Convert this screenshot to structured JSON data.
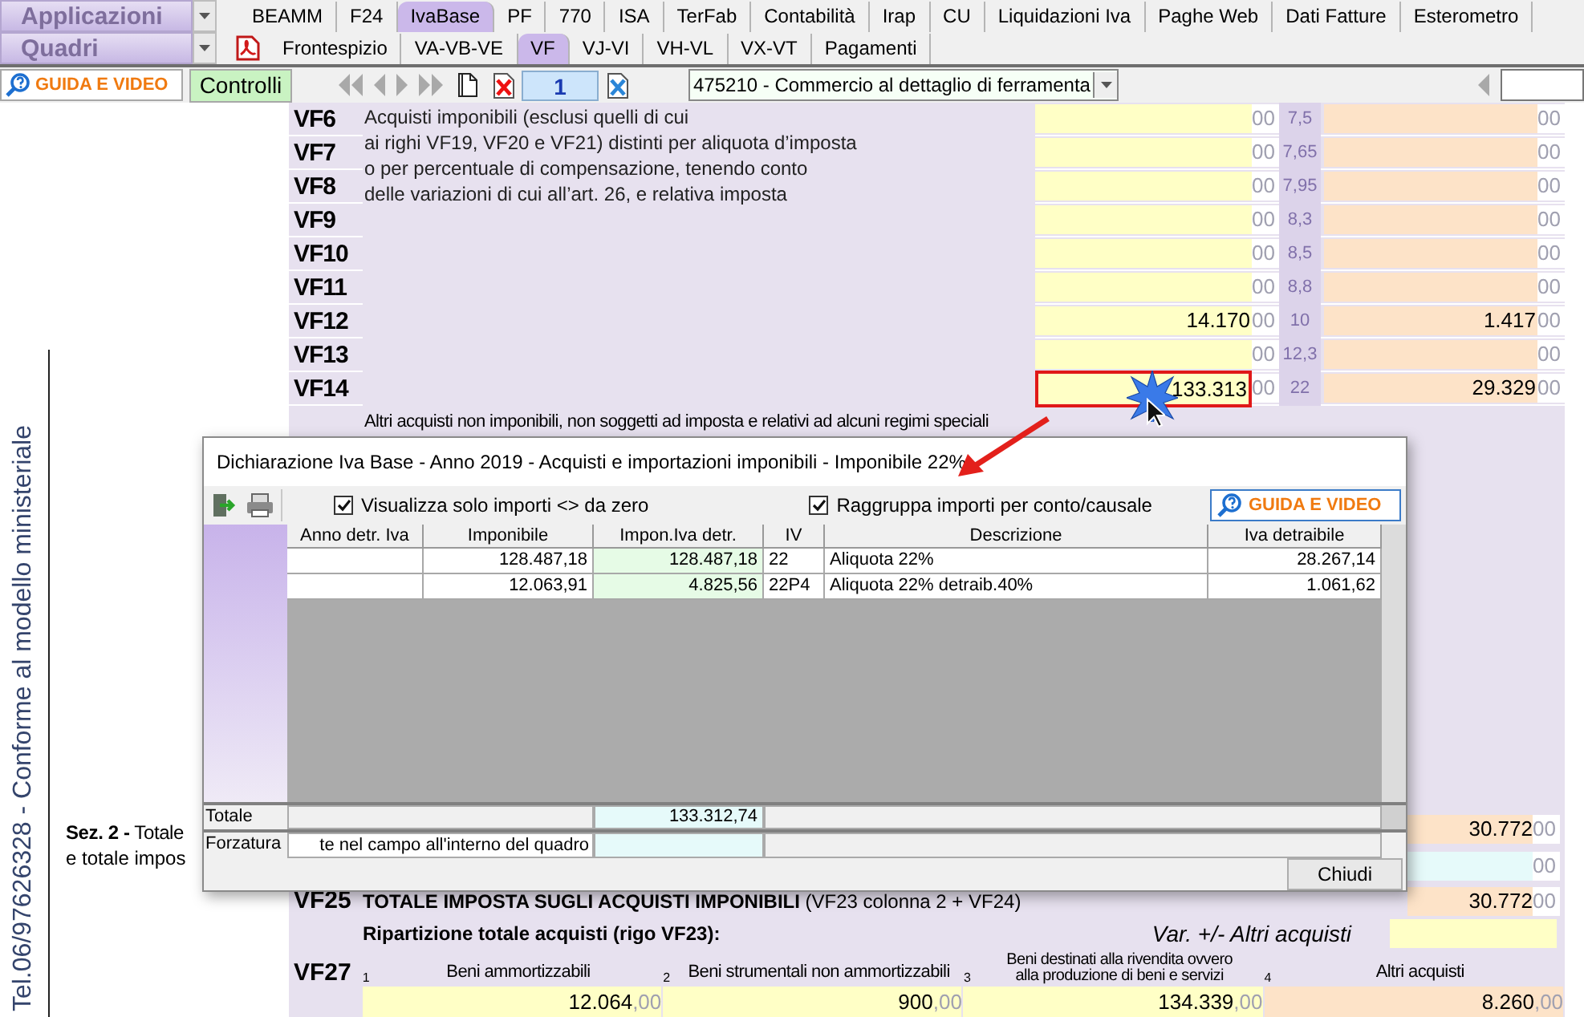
{
  "menus": [
    {
      "label": "Applicazioni"
    },
    {
      "label": "Quadri"
    }
  ],
  "app_tabs": [
    {
      "label": "BEAMM",
      "selected": false
    },
    {
      "label": "F24",
      "selected": false
    },
    {
      "label": "IvaBase",
      "selected": true
    },
    {
      "label": "PF",
      "selected": false
    },
    {
      "label": "770",
      "selected": false
    },
    {
      "label": "ISA",
      "selected": false
    },
    {
      "label": "TerFab",
      "selected": false
    },
    {
      "label": "Contabilità",
      "selected": false
    },
    {
      "label": "Irap",
      "selected": false
    },
    {
      "label": "CU",
      "selected": false
    },
    {
      "label": "Liquidazioni Iva",
      "selected": false
    },
    {
      "label": "Paghe Web",
      "selected": false
    },
    {
      "label": "Dati Fatture",
      "selected": false
    },
    {
      "label": "Esterometro",
      "selected": false
    }
  ],
  "quadri_tabs": [
    {
      "label": "Frontespizio",
      "selected": false
    },
    {
      "label": "VA-VB-VE",
      "selected": false
    },
    {
      "label": "VF",
      "selected": true
    },
    {
      "label": "VJ-VI",
      "selected": false
    },
    {
      "label": "VH-VL",
      "selected": false
    },
    {
      "label": "VX-VT",
      "selected": false
    },
    {
      "label": "Pagamenti",
      "selected": false
    }
  ],
  "toolbar": {
    "help_button": "GUIDA E VIDEO",
    "controls_button": "Controlli",
    "page": "1",
    "activity": "475210 - Commercio al dettaglio di ferramenta"
  },
  "side_text": "Tel.06/97626328 - Conforme al modello ministeriale",
  "vf_description": [
    "Acquisti imponibili (esclusi quelli di cui",
    "ai righi VF19, VF20 e VF21) distinti per aliquota d’imposta",
    "o per percentuale di compensazione, tenendo conto",
    "delle variazioni di cui all’art. 26, e relativa imposta"
  ],
  "vf_rows": [
    {
      "code": "VF6",
      "cents": "00",
      "rate": "7,5",
      "tax_cents": "00",
      "highlighted": false
    },
    {
      "code": "VF7",
      "cents": "00",
      "rate": "7,65",
      "tax_cents": "00",
      "highlighted": false
    },
    {
      "code": "VF8",
      "cents": "00",
      "rate": "7,95",
      "tax_cents": "00",
      "highlighted": false
    },
    {
      "code": "VF9",
      "cents": "00",
      "rate": "8,3",
      "tax_cents": "00",
      "highlighted": false
    },
    {
      "code": "VF10",
      "cents": "00",
      "rate": "8,5",
      "tax_cents": "00",
      "highlighted": false
    },
    {
      "code": "VF11",
      "cents": "00",
      "rate": "8,8",
      "tax_cents": "00",
      "highlighted": false
    },
    {
      "code": "VF12",
      "taxable": "14.170",
      "cents": "00",
      "rate": "10",
      "tax": "1.417",
      "tax_cents": "00",
      "highlighted": false
    },
    {
      "code": "VF13",
      "cents": "00",
      "rate": "12,3",
      "tax_cents": "00",
      "highlighted": false
    },
    {
      "code": "VF14",
      "taxable": "133.313",
      "cents": "00",
      "rate": "22",
      "tax": "29.329",
      "tax_cents": "00",
      "highlighted": true
    }
  ],
  "vf15": {
    "text": "Altri acquisti non imponibili, non soggetti ad imposta e relativi ad alcuni regimi speciali"
  },
  "section2": {
    "title": "**Sez. 2 -** Totale",
    "subtitle": "e totale impos",
    "total": "30.772",
    "total_cents": "00",
    "vf24_cents": "00"
  },
  "vf25": {
    "code": "VF25",
    "label": "TOTALE IMPOSTA SUGLI ACQUISTI IMPONIBILI",
    "note": "(VF23 colonna 2 + VF24)",
    "value": "30.772",
    "cents": "00"
  },
  "breakdown": {
    "title": "Ripartizione totale acquisti (rigo VF23):",
    "variation_label": "Var. +/- Altri acquisti",
    "code": "VF27",
    "columns": [
      {
        "number": "1",
        "label_lines": [
          "Beni ammortizzabili"
        ],
        "value": "12.064",
        "cents": ",00",
        "kind": "purchase"
      },
      {
        "number": "2",
        "label_lines": [
          "Beni strumentali non ammortizzabili"
        ],
        "value": "900",
        "cents": ",00",
        "kind": "purchase"
      },
      {
        "number": "3",
        "label_lines": [
          "Beni destinati alla rivendita ovvero",
          "alla produzione di beni e servizi"
        ],
        "value": "134.339",
        "cents": ",00",
        "kind": "purchase"
      },
      {
        "number": "4",
        "label_lines": [
          "Altri acquisti"
        ],
        "value": "8.260",
        "cents": ",00",
        "kind": "other"
      }
    ]
  },
  "dialog": {
    "title": "Dichiarazione Iva Base - Anno 2019 - Acquisti e importazioni imponibili - Imponibile 22%",
    "options": [
      {
        "label": "Visualizza solo importi <> da zero",
        "checked": true
      },
      {
        "label": "Raggruppa importi per conto/causale",
        "checked": true
      }
    ],
    "help_button": "GUIDA E VIDEO",
    "columns": [
      "Anno detr. Iva",
      "Imponibile",
      "Impon.Iva detr.",
      "IV",
      "Descrizione",
      "Iva detraibile"
    ],
    "rows": [
      [
        "",
        "128.487,18",
        "128.487,18",
        "22",
        "Aliquota 22%",
        "28.267,14"
      ],
      [
        "",
        "12.063,91",
        "4.825,56",
        "22P4",
        "Aliquota 22% detraib.40%",
        "1.061,62"
      ]
    ],
    "total_label": "Totale",
    "total_value": "133.312,74",
    "override_label": "Forzatura",
    "override_text": "te nel campo all'interno del quadro",
    "close_button": "Chiudi"
  }
}
